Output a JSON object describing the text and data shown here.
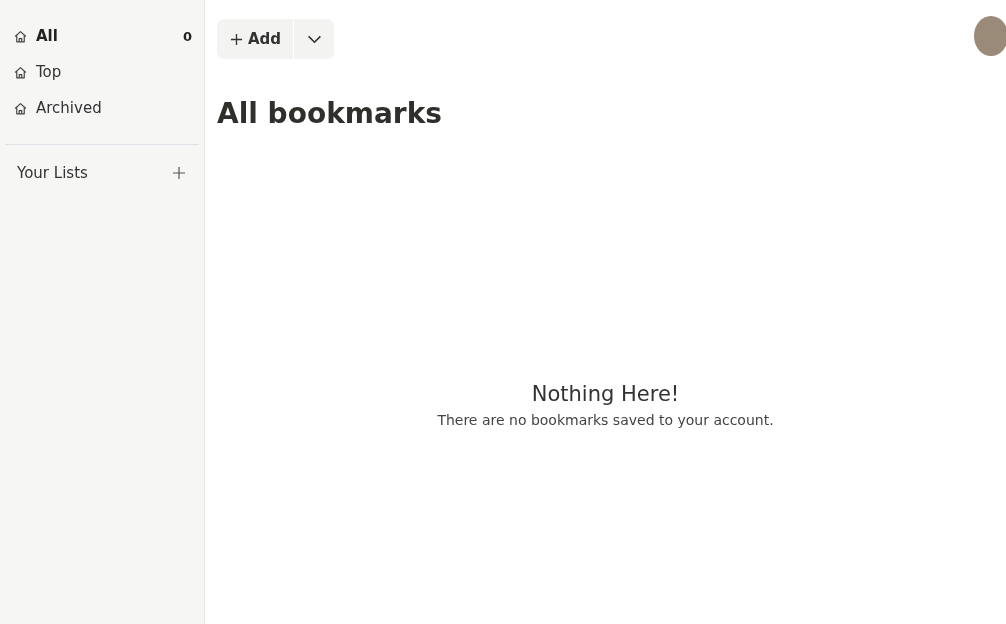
{
  "sidebar": {
    "items": [
      {
        "label": "All",
        "count": "0",
        "selected": true
      },
      {
        "label": "Top",
        "selected": false
      },
      {
        "label": "Archived",
        "selected": false
      }
    ],
    "lists_heading": "Your Lists"
  },
  "toolbar": {
    "add_button": "Add"
  },
  "main": {
    "title": "All bookmarks",
    "empty_title": "Nothing Here!",
    "empty_message": "There are no bookmarks saved to your account."
  }
}
